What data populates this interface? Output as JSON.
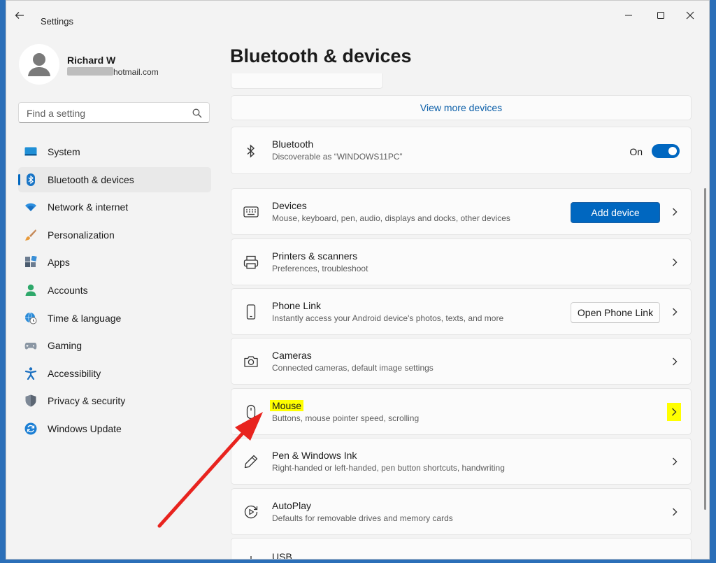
{
  "window": {
    "title": "Settings"
  },
  "user": {
    "name": "Richard W",
    "email_suffix": "hotmail.com"
  },
  "search": {
    "placeholder": "Find a setting"
  },
  "sidebar": {
    "items": [
      {
        "label": "System",
        "icon": "system-icon"
      },
      {
        "label": "Bluetooth & devices",
        "icon": "bluetooth-icon",
        "selected": true
      },
      {
        "label": "Network & internet",
        "icon": "wifi-icon"
      },
      {
        "label": "Personalization",
        "icon": "brush-icon"
      },
      {
        "label": "Apps",
        "icon": "apps-icon"
      },
      {
        "label": "Accounts",
        "icon": "person-icon"
      },
      {
        "label": "Time & language",
        "icon": "globe-clock-icon"
      },
      {
        "label": "Gaming",
        "icon": "gamepad-icon"
      },
      {
        "label": "Accessibility",
        "icon": "accessibility-icon"
      },
      {
        "label": "Privacy & security",
        "icon": "shield-icon"
      },
      {
        "label": "Windows Update",
        "icon": "update-icon"
      }
    ]
  },
  "main": {
    "title": "Bluetooth & devices",
    "view_more": "View more devices",
    "bluetooth": {
      "title": "Bluetooth",
      "desc": "Discoverable as “WINDOWS11PC”",
      "state": "On"
    },
    "rows": [
      {
        "title": "Devices",
        "desc": "Mouse, keyboard, pen, audio, displays and docks, other devices",
        "button": "Add device",
        "icon": "keyboard-icon"
      },
      {
        "title": "Printers & scanners",
        "desc": "Preferences, troubleshoot",
        "icon": "printer-icon"
      },
      {
        "title": "Phone Link",
        "desc": "Instantly access your Android device's photos, texts, and more",
        "button": "Open Phone Link",
        "icon": "phone-icon"
      },
      {
        "title": "Cameras",
        "desc": "Connected cameras, default image settings",
        "icon": "camera-icon"
      },
      {
        "title": "Mouse",
        "desc": "Buttons, mouse pointer speed, scrolling",
        "icon": "mouse-icon",
        "highlighted": true
      },
      {
        "title": "Pen & Windows Ink",
        "desc": "Right-handed or left-handed, pen button shortcuts, handwriting",
        "icon": "pen-icon"
      },
      {
        "title": "AutoPlay",
        "desc": "Defaults for removable drives and memory cards",
        "icon": "autoplay-icon"
      },
      {
        "title": "USB",
        "icon": "usb-icon"
      }
    ]
  },
  "colors": {
    "accent": "#0067c0",
    "highlight": "#ffff00",
    "annotation_arrow": "#e8231e"
  }
}
